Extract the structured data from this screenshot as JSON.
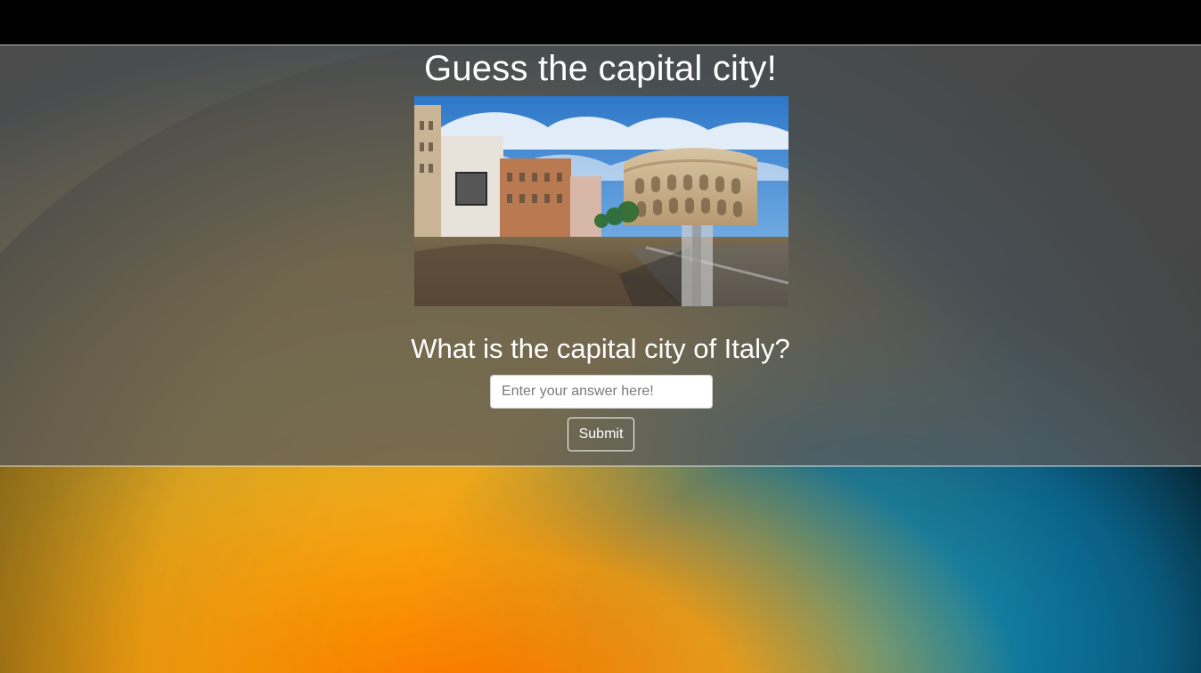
{
  "page": {
    "title": "Guess the capital city!",
    "question": "What is the capital city of Italy?"
  },
  "form": {
    "answer_placeholder": "Enter your answer here!",
    "answer_value": "",
    "submit_label": "Submit"
  },
  "colors": {
    "top_bar": "#000000",
    "panel_overlay": "#5a5a5a",
    "text": "#ffffff"
  }
}
